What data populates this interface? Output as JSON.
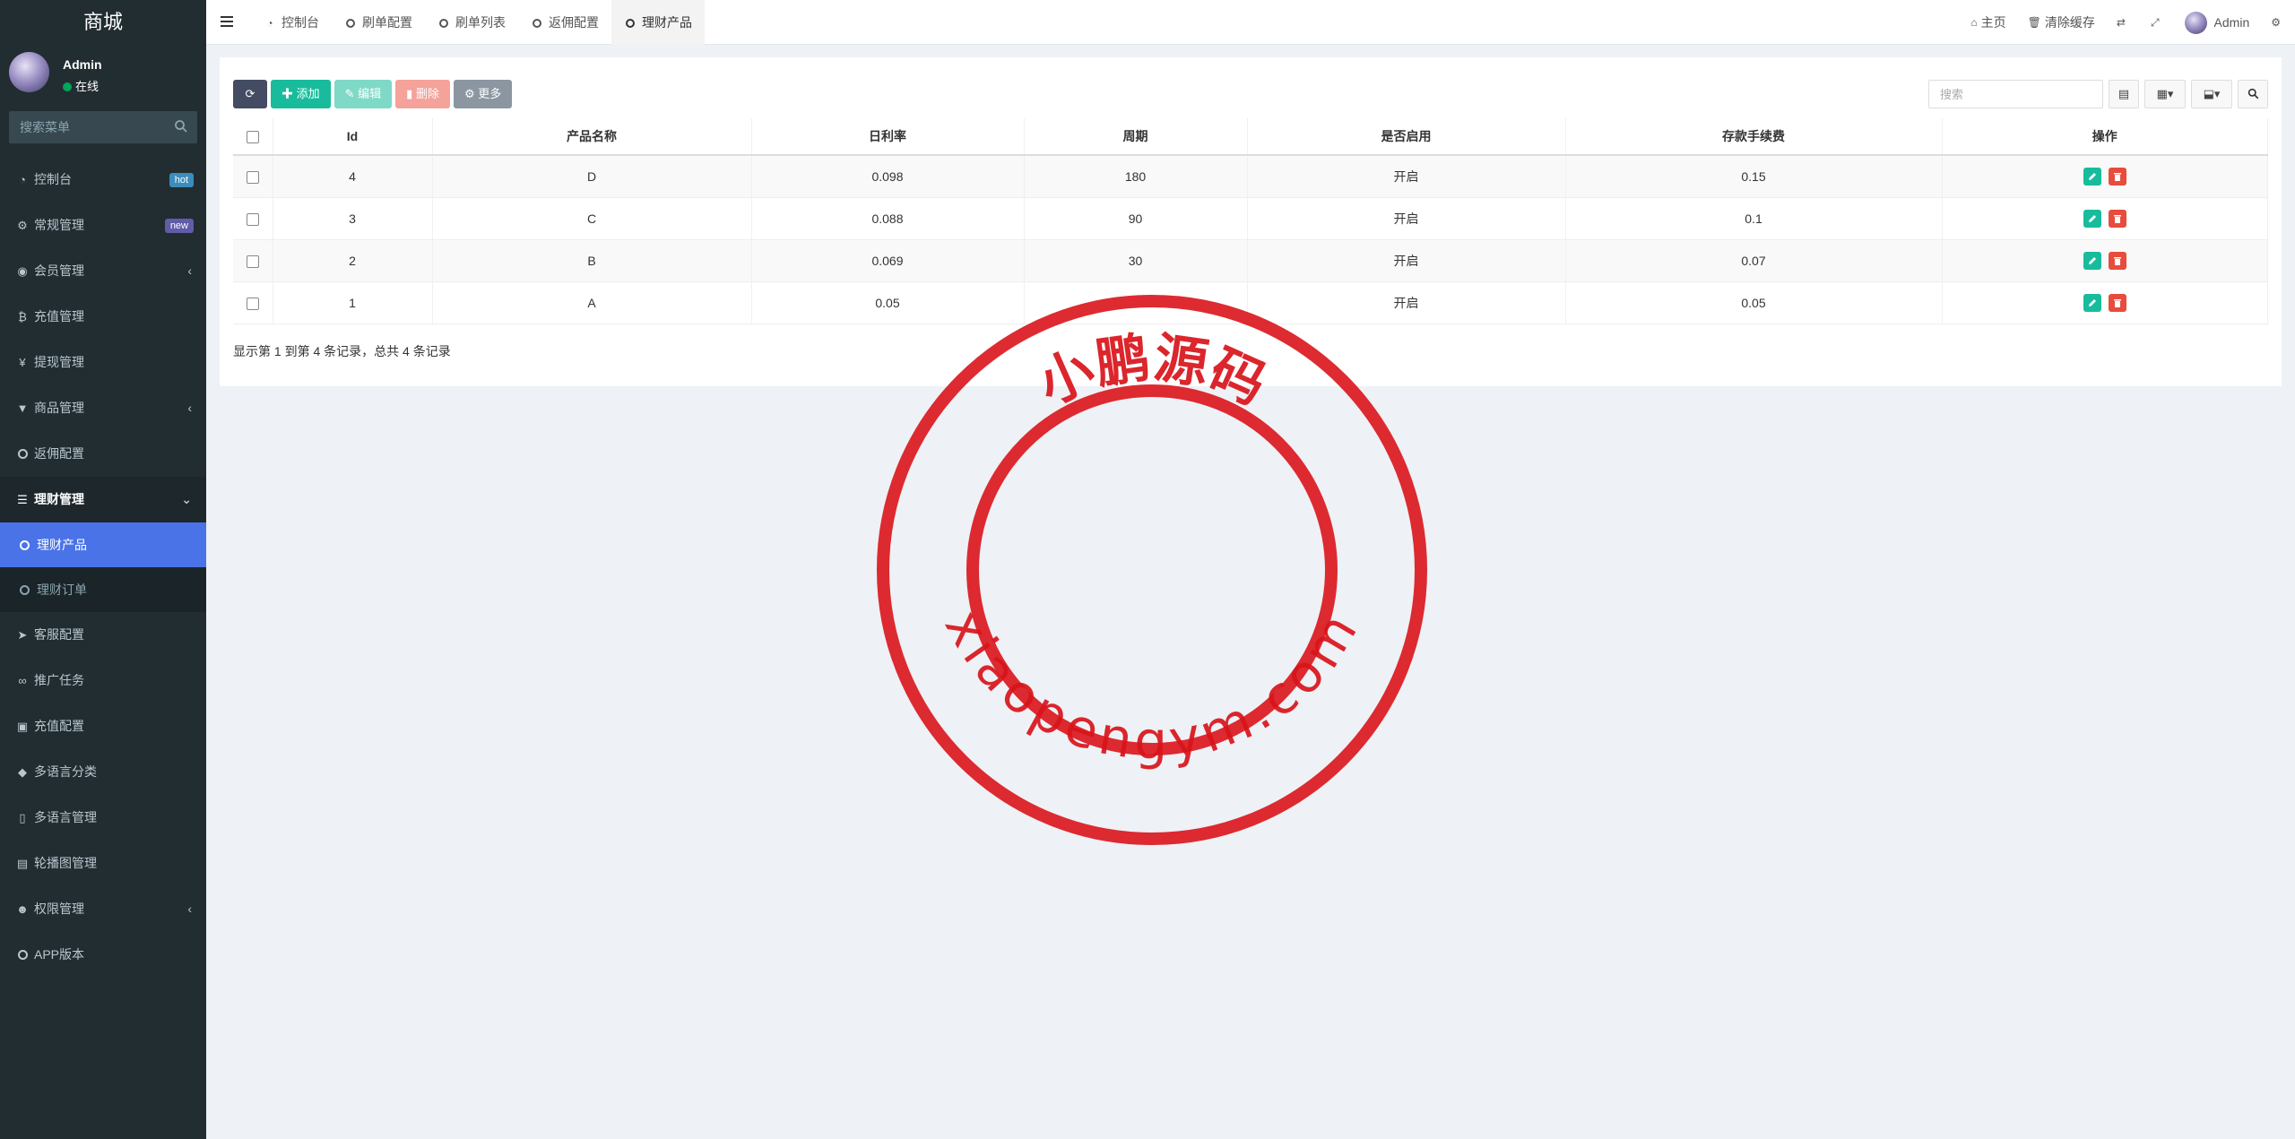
{
  "sidebar": {
    "brand": "商城",
    "user": {
      "name": "Admin",
      "status": "在线"
    },
    "search_placeholder": "搜索菜单",
    "items": [
      {
        "label": "控制台",
        "icon": "dashboard-icon",
        "badge": "hot"
      },
      {
        "label": "常规管理",
        "icon": "cogs-icon",
        "badge": "new"
      },
      {
        "label": "会员管理",
        "icon": "user-circle-icon",
        "caret": "‹"
      },
      {
        "label": "充值管理",
        "icon": "bitcoin-icon"
      },
      {
        "label": "提现管理",
        "icon": "yen-icon"
      },
      {
        "label": "商品管理",
        "icon": "cart-icon",
        "caret": "‹"
      },
      {
        "label": "返佣配置",
        "icon": "circle-icon"
      },
      {
        "label": "理财管理",
        "icon": "list-icon",
        "caret": "⌄"
      }
    ],
    "sub_items": [
      {
        "label": "理财产品"
      },
      {
        "label": "理财订单"
      }
    ],
    "items_after": [
      {
        "label": "客服配置",
        "icon": "telegram-icon"
      },
      {
        "label": "推广任务",
        "icon": "link-icon"
      },
      {
        "label": "充值配置",
        "icon": "image-icon"
      },
      {
        "label": "多语言分类",
        "icon": "tag-icon"
      },
      {
        "label": "多语言管理",
        "icon": "mobile-icon"
      },
      {
        "label": "轮播图管理",
        "icon": "file-image-icon"
      },
      {
        "label": "权限管理",
        "icon": "users-icon",
        "caret": "‹"
      },
      {
        "label": "APP版本",
        "icon": "circle-icon"
      }
    ]
  },
  "topbar": {
    "tabs": [
      {
        "label": "控制台",
        "icon": "dashboard-icon"
      },
      {
        "label": "刷单配置",
        "icon": "circle-icon"
      },
      {
        "label": "刷单列表",
        "icon": "circle-icon"
      },
      {
        "label": "返佣配置",
        "icon": "circle-icon"
      },
      {
        "label": "理财产品",
        "icon": "circle-icon"
      }
    ],
    "home": "主页",
    "clear_cache": "清除缓存",
    "user": "Admin"
  },
  "toolbar": {
    "add": "添加",
    "edit": "编辑",
    "delete": "删除",
    "more": "更多",
    "search_placeholder": "搜索"
  },
  "table": {
    "columns": [
      "Id",
      "产品名称",
      "日利率",
      "周期",
      "是否启用",
      "存款手续费",
      "操作"
    ],
    "rows": [
      {
        "id": "4",
        "name": "D",
        "rate": "0.098",
        "period": "180",
        "enabled": "开启",
        "fee": "0.15"
      },
      {
        "id": "3",
        "name": "C",
        "rate": "0.088",
        "period": "90",
        "enabled": "开启",
        "fee": "0.1"
      },
      {
        "id": "2",
        "name": "B",
        "rate": "0.069",
        "period": "30",
        "enabled": "开启",
        "fee": "0.07"
      },
      {
        "id": "1",
        "name": "A",
        "rate": "0.05",
        "period": "",
        "enabled": "开启",
        "fee": "0.05"
      }
    ],
    "summary": "显示第 1 到第 4 条记录，总共 4 条记录"
  },
  "watermark": {
    "top_text": "小鹏源码",
    "bottom_text": "xiaopengym.com",
    "color": "#d9141b"
  },
  "colors": {
    "sidebar_bg": "#222d32",
    "active_item": "#4a73e8",
    "primary_green": "#18bc9c",
    "danger_red": "#e74c3c"
  }
}
